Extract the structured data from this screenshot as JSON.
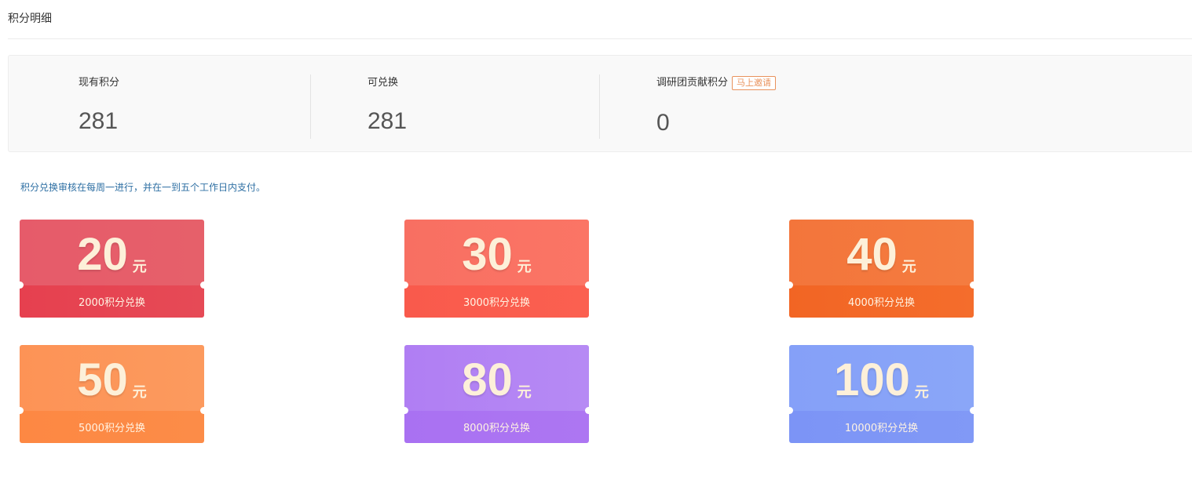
{
  "page": {
    "title": "积分明细"
  },
  "stats": {
    "current": {
      "label": "现有积分",
      "value": "281"
    },
    "exchangeable": {
      "label": "可兑换",
      "value": "281"
    },
    "team": {
      "label": "调研团贡献积分",
      "value": "0",
      "invite_label": "马上邀请"
    }
  },
  "notice": "积分兑换审核在每周一进行，并在一到五个工作日内支付。",
  "coupons": [
    {
      "amount": "20",
      "unit": "元",
      "caption": "2000积分兑换"
    },
    {
      "amount": "30",
      "unit": "元",
      "caption": "3000积分兑换"
    },
    {
      "amount": "40",
      "unit": "元",
      "caption": "4000积分兑换"
    },
    {
      "amount": "50",
      "unit": "元",
      "caption": "5000积分兑换"
    },
    {
      "amount": "80",
      "unit": "元",
      "caption": "8000积分兑换"
    },
    {
      "amount": "100",
      "unit": "元",
      "caption": "10000积分兑换"
    }
  ],
  "colors": {
    "coupon_20": "#e65b6a",
    "coupon_30": "#f86f62",
    "coupon_40": "#f3753b",
    "coupon_50": "#fd9356",
    "coupon_80": "#b07ef3",
    "coupon_100": "#85a0f8",
    "invite_accent": "#e9925c",
    "notice_text": "#2e6fa3"
  }
}
